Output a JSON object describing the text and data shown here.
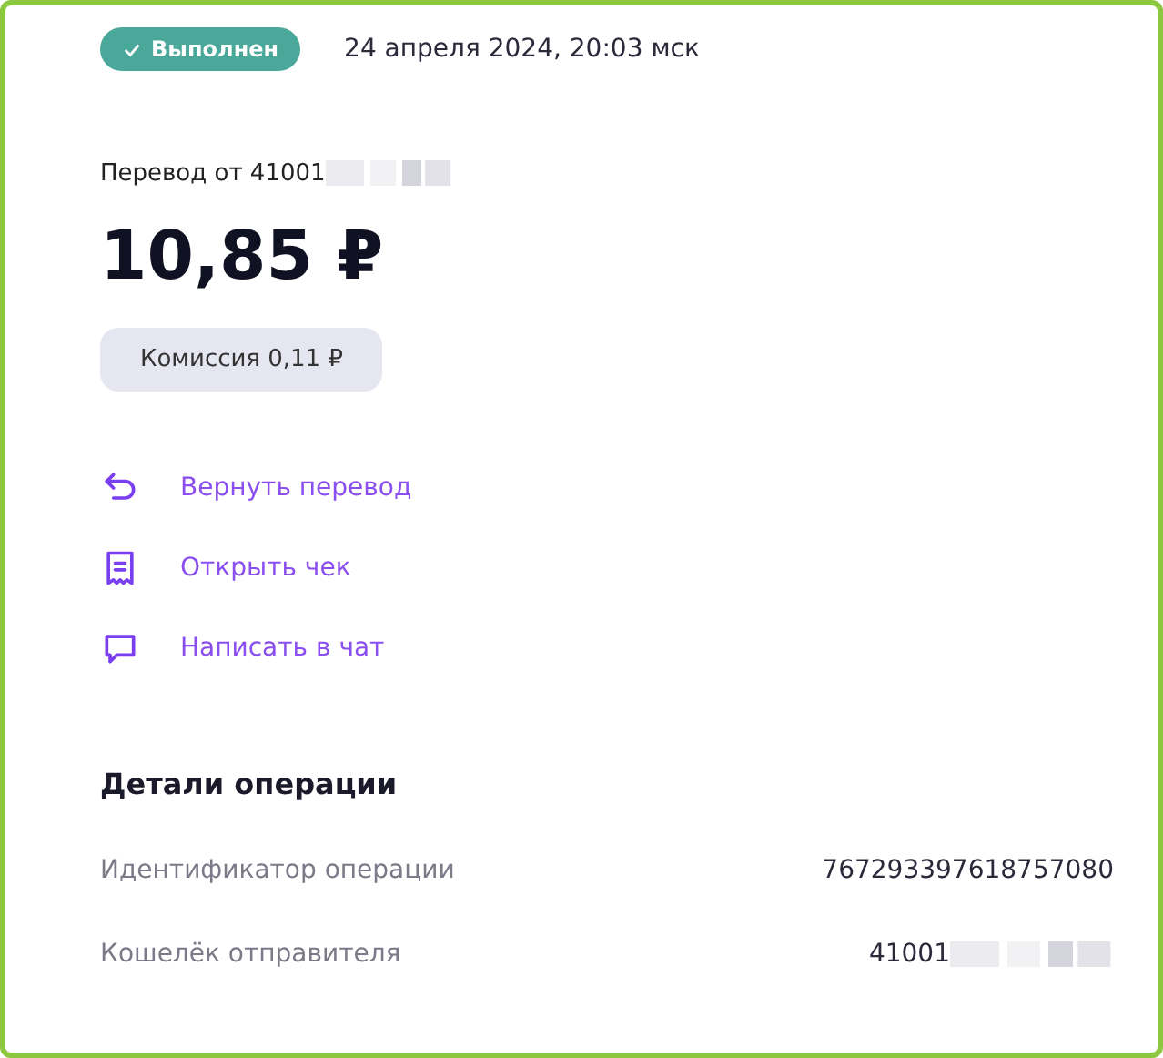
{
  "status": {
    "label": "Выполнен",
    "done": true
  },
  "datetime": "24 апреля 2024, 20:03 мск",
  "transfer_from": "Перевод от 41001",
  "amount": "10,85 ₽",
  "commission": "Комиссия 0,11 ₽",
  "actions": [
    {
      "kind": "return",
      "label": "Вернуть перевод"
    },
    {
      "kind": "receipt",
      "label": "Открыть чек"
    },
    {
      "kind": "chat",
      "label": "Написать в чат"
    }
  ],
  "details": {
    "title": "Детали операции",
    "rows": [
      {
        "label": "Идентификатор операции",
        "value": "767293397618757080",
        "redacted": false
      },
      {
        "label": "Кошелёк отправителя",
        "value": "41001",
        "redacted": true
      }
    ]
  }
}
